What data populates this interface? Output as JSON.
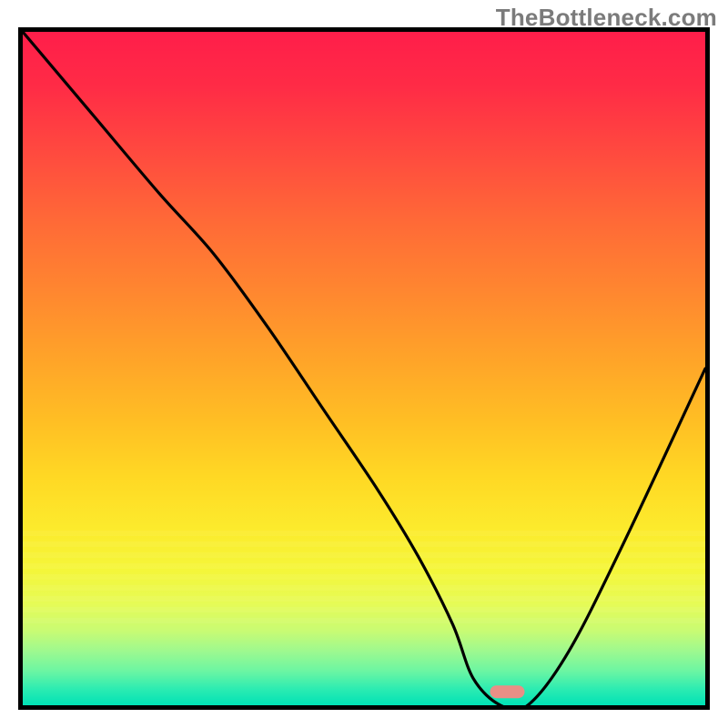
{
  "watermark": "TheBottleneck.com",
  "chart_data": {
    "type": "line",
    "title": "",
    "xlabel": "",
    "ylabel": "",
    "xlim": [
      0,
      100
    ],
    "ylim": [
      0,
      100
    ],
    "grid": false,
    "legend": false,
    "background_gradient": {
      "top": "#ff1e4a",
      "mid": "#ffd824",
      "bottom": "#00e2b6"
    },
    "series": [
      {
        "name": "bottleneck-curve",
        "color": "#000000",
        "x": [
          0,
          10,
          20,
          28,
          36,
          44,
          52,
          58,
          63,
          66,
          70,
          74,
          80,
          88,
          100
        ],
        "y": [
          100,
          88,
          76,
          67,
          56,
          44,
          32,
          22,
          12,
          4,
          0,
          0,
          8,
          24,
          50
        ]
      }
    ],
    "marker": {
      "name": "optimal-point",
      "x": 71,
      "y": 2,
      "color": "#e88f86",
      "shape": "pill"
    }
  }
}
